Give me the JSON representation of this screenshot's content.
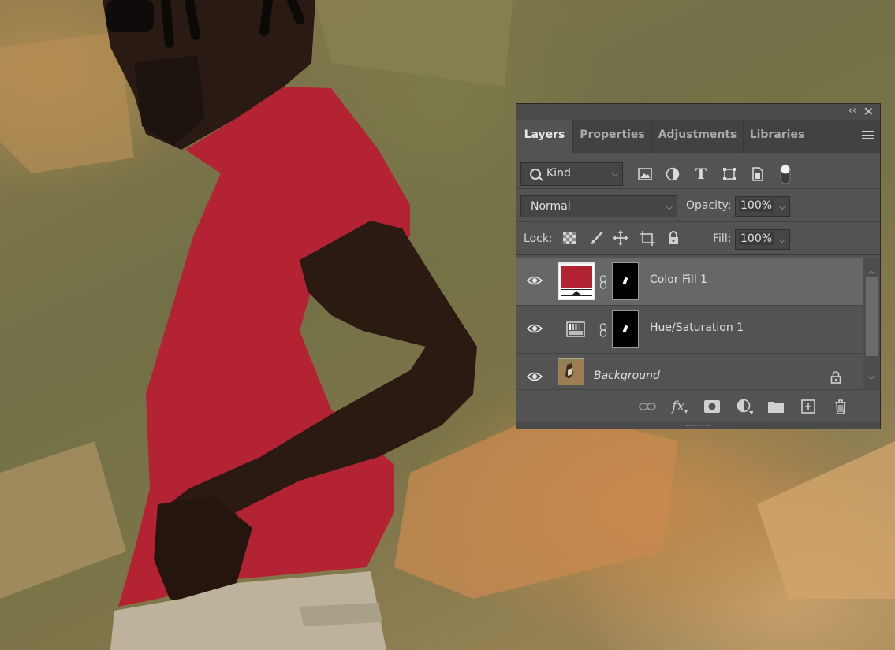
{
  "colors": {
    "shirt_fill": "#b32334",
    "panel_bg": "#535353",
    "selected_layer": "#676767"
  },
  "panel": {
    "collapse_icon": "double-chevron-left-icon",
    "close_icon": "close-icon",
    "tabs": [
      {
        "label": "Layers",
        "active": true
      },
      {
        "label": "Properties",
        "active": false
      },
      {
        "label": "Adjustments",
        "active": false
      },
      {
        "label": "Libraries",
        "active": false
      }
    ],
    "filter": {
      "kind_label": "Kind",
      "icons": [
        "image-filter-icon",
        "adjustment-filter-icon",
        "type-filter-icon",
        "shape-filter-icon",
        "smart-object-filter-icon",
        "filter-toggle-icon"
      ]
    },
    "blend": {
      "mode": "Normal",
      "opacity_label": "Opacity:",
      "opacity_value": "100%"
    },
    "lock": {
      "label": "Lock:",
      "icons": [
        "lock-transparent-pixels-icon",
        "lock-image-pixels-icon",
        "lock-position-icon",
        "lock-artboard-icon",
        "lock-all-icon"
      ],
      "fill_label": "Fill:",
      "fill_value": "100%"
    },
    "layers": [
      {
        "name": "Color Fill 1",
        "visible": true,
        "selected": true
      },
      {
        "name": "Hue/Saturation 1",
        "visible": true,
        "selected": false
      },
      {
        "name": "Background",
        "visible": true,
        "selected": false,
        "locked": true
      }
    ],
    "footer_icons": [
      "link-layers-icon",
      "fx-icon",
      "add-mask-icon",
      "new-adjustment-icon",
      "new-group-icon",
      "new-layer-icon",
      "delete-layer-icon"
    ],
    "fx_label": "fx"
  }
}
